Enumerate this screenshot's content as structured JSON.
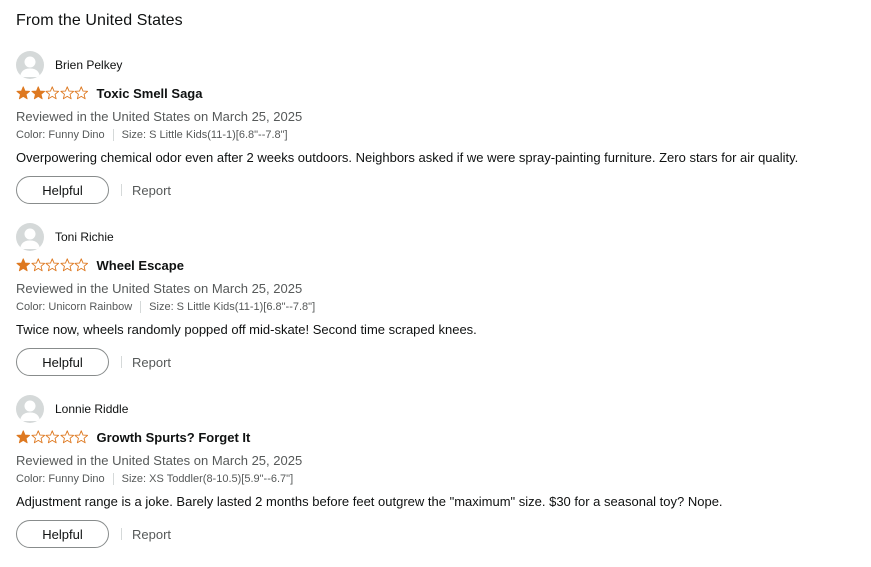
{
  "section": {
    "title": "From the United States"
  },
  "colors": {
    "star_fill": "#de7921",
    "star_outline": "#de7921"
  },
  "reviews": [
    {
      "reviewer": "Brien Pelkey",
      "rating": 2,
      "title": "Toxic Smell Saga",
      "meta": "Reviewed in the United States on March 25, 2025",
      "color": "Color: Funny Dino",
      "size": "Size: S Little Kids(11-1)[6.8\"--7.8\"]",
      "body": "Overpowering chemical odor even after 2 weeks outdoors. Neighbors asked if we were spray-painting furniture. Zero stars for air quality.",
      "helpful_label": "Helpful",
      "report_label": "Report"
    },
    {
      "reviewer": "Toni Richie",
      "rating": 1,
      "title": "Wheel Escape",
      "meta": "Reviewed in the United States on March 25, 2025",
      "color": "Color: Unicorn Rainbow",
      "size": "Size: S Little Kids(11-1)[6.8\"--7.8\"]",
      "body": "Twice now, wheels randomly popped off mid-skate! Second time scraped knees.",
      "helpful_label": "Helpful",
      "report_label": "Report"
    },
    {
      "reviewer": "Lonnie Riddle",
      "rating": 1,
      "title": "Growth Spurts? Forget It",
      "meta": "Reviewed in the United States on March 25, 2025",
      "color": "Color: Funny Dino",
      "size": "Size: XS Toddler(8-10.5)[5.9\"--6.7\"]",
      "body": "Adjustment range is a joke. Barely lasted 2 months before feet outgrew the \"maximum\" size. $30 for a seasonal toy? Nope.",
      "helpful_label": "Helpful",
      "report_label": "Report"
    }
  ]
}
